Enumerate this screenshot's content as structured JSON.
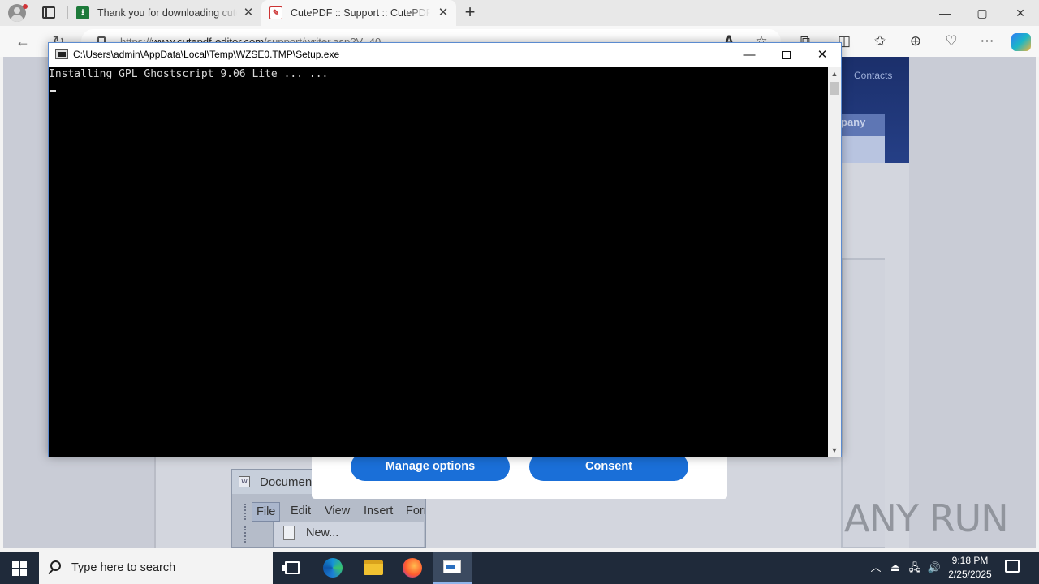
{
  "browser": {
    "tabs": [
      {
        "title": "Thank you for downloading cutepdf-editor",
        "favicon": "green-download-icon"
      },
      {
        "title": "CutePDF :: Support :: CutePDF Writer",
        "favicon": "cutepdf-icon"
      }
    ],
    "url": {
      "prefix": "https://",
      "domain": "www.cutepdf-editor.com",
      "path": "/support/writer.asp?V=40"
    },
    "new_tab_symbol": "+",
    "window_controls": {
      "minimize": "—",
      "restore": "▢",
      "close": "✕"
    }
  },
  "page": {
    "nav_contacts": "Contacts",
    "company_label": "pany",
    "consent": {
      "manage_label": "Manage options",
      "consent_label": "Consent"
    },
    "word_demo": {
      "title": "Document",
      "menu": [
        "File",
        "Edit",
        "View",
        "Insert",
        "Form"
      ],
      "submenu_item": "New..."
    },
    "watermark": "ANY RUN"
  },
  "console": {
    "title": "C:\\Users\\admin\\AppData\\Local\\Temp\\WZSE0.TMP\\Setup.exe",
    "output": "Installing GPL Ghostscript 9.06 Lite ... ...",
    "controls": {
      "minimize": "—",
      "close": "✕"
    }
  },
  "taskbar": {
    "search_placeholder": "Type here to search",
    "time": "9:18 PM",
    "date": "2/25/2025",
    "colors": {
      "background": "#1f2a3a",
      "accent": "#8fb4ea"
    }
  }
}
